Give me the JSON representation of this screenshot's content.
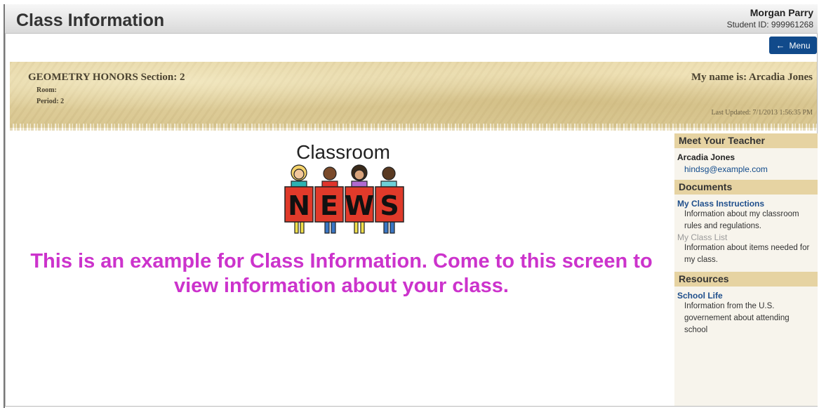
{
  "header": {
    "title": "Class Information",
    "user_name": "Morgan Parry",
    "student_id": "Student ID: 999961268"
  },
  "menu_button": {
    "label": "Menu",
    "icon": "arrow-left-icon"
  },
  "banner": {
    "class_name": "GEOMETRY HONORS Section: 2",
    "room": "Room:",
    "period": "Period: 2",
    "my_name": "My name is: Arcadia Jones",
    "last_updated": "Last Updated: 7/1/2013 1:56:35 PM"
  },
  "main": {
    "image_caption": "Classroom",
    "image_letters": [
      "N",
      "E",
      "W",
      "S"
    ],
    "message": "This is an example for Class Information. Come to this screen to view information about your class."
  },
  "sidebar": {
    "teacher": {
      "heading": "Meet Your Teacher",
      "name": "Arcadia Jones",
      "email": "hindsg@example.com"
    },
    "documents": {
      "heading": "Documents",
      "items": [
        {
          "title": "My Class Instructions",
          "desc": "Information about my classroom rules and regulations."
        },
        {
          "title": "My Class List",
          "desc": "Information about items needed for my class."
        }
      ]
    },
    "resources": {
      "heading": "Resources",
      "items": [
        {
          "title": "School Life",
          "desc": "Information from the U.S. governement about attending school"
        }
      ]
    }
  },
  "colors": {
    "accent": "#114a8b",
    "message": "#cc33cc",
    "sidebar_heading": "#e6d3a2"
  }
}
